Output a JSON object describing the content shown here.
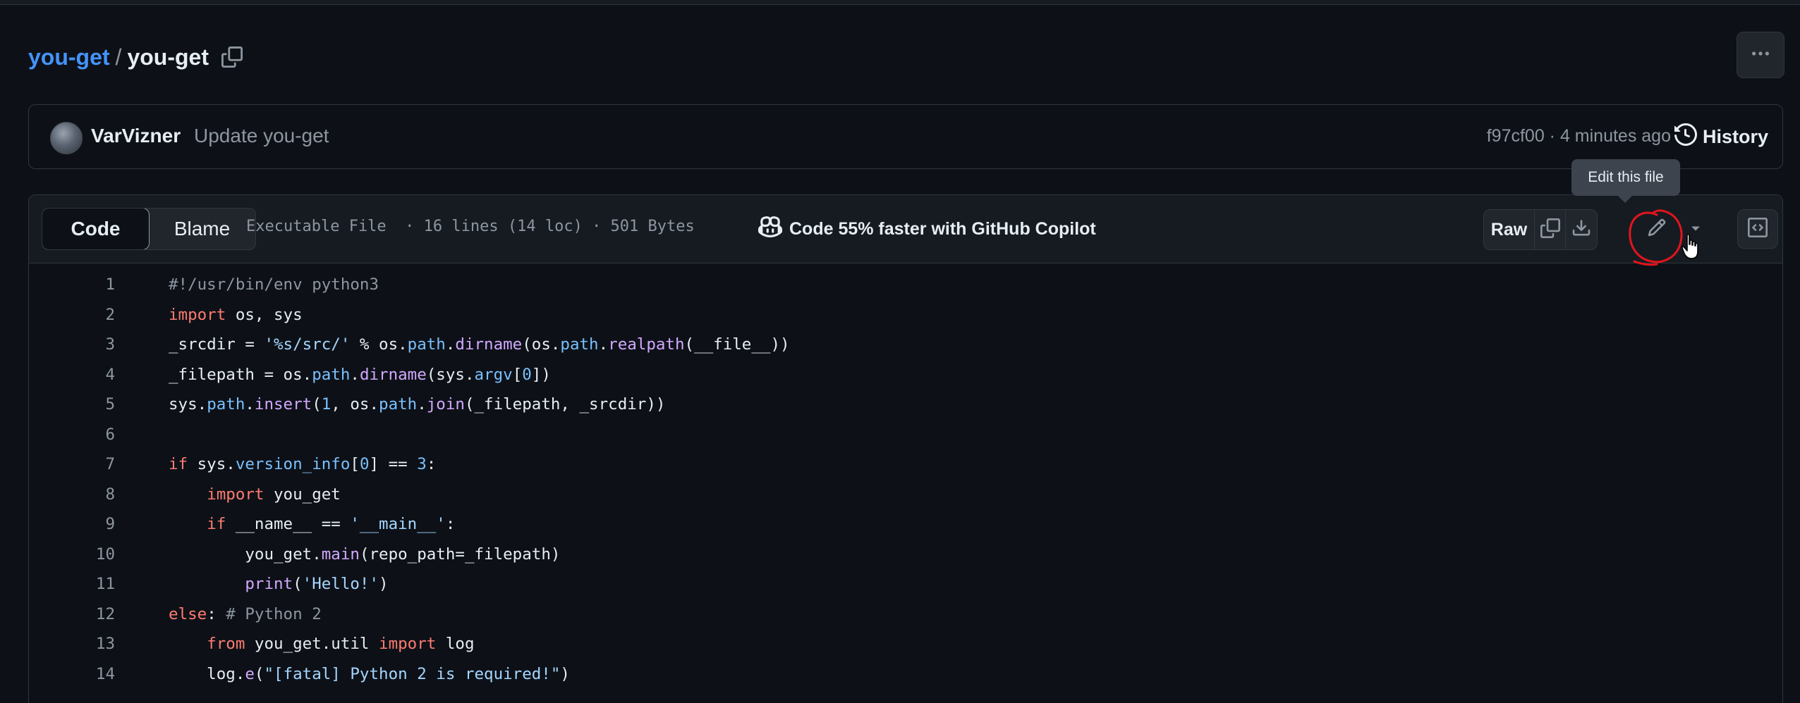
{
  "breadcrumb": {
    "repo": "you-get",
    "separator": "/",
    "file": "you-get"
  },
  "commit": {
    "author": "VarVizner",
    "message": "Update you-get",
    "meta": "f97cf00 · 4 minutes ago",
    "history_label": "History"
  },
  "tooltip": {
    "text": "Edit this file"
  },
  "file_header": {
    "tabs": [
      {
        "label": "Code",
        "active": true
      },
      {
        "label": "Blame",
        "active": false
      }
    ],
    "info": "Executable File  · 16 lines (14 loc) · 501 Bytes",
    "copilot": "Code 55% faster with GitHub Copilot",
    "raw_label": "Raw"
  },
  "icons": {
    "copy_path": "copy-icon",
    "more": "kebab-horizontal-icon",
    "history": "history-icon",
    "copilot": "copilot-icon",
    "copy_raw": "copy-icon",
    "download": "download-icon",
    "edit": "pencil-icon",
    "dropdown": "triangle-down-icon",
    "symbols": "code-square-icon"
  },
  "colors": {
    "background": "#0d1117",
    "link": "#4493f8",
    "annotation": "#e5141b"
  },
  "code_lines": [
    {
      "n": "1",
      "tokens": [
        [
          "cm",
          "#!/usr/bin/env python3"
        ]
      ]
    },
    {
      "n": "2",
      "tokens": [
        [
          "kw",
          "import"
        ],
        [
          "",
          " os, sys"
        ]
      ]
    },
    {
      "n": "3",
      "tokens": [
        [
          "",
          "_srcdir = "
        ],
        [
          "str",
          "'%s/src/'"
        ],
        [
          "",
          " % os."
        ],
        [
          "attr",
          "path"
        ],
        [
          "",
          "."
        ],
        [
          "fn",
          "dirname"
        ],
        [
          "",
          "(os."
        ],
        [
          "attr",
          "path"
        ],
        [
          "",
          "."
        ],
        [
          "fn",
          "realpath"
        ],
        [
          "",
          "(__file__))"
        ]
      ]
    },
    {
      "n": "4",
      "tokens": [
        [
          "",
          "_filepath = os."
        ],
        [
          "attr",
          "path"
        ],
        [
          "",
          "."
        ],
        [
          "fn",
          "dirname"
        ],
        [
          "",
          "(sys."
        ],
        [
          "attr",
          "argv"
        ],
        [
          "",
          "["
        ],
        [
          "num",
          "0"
        ],
        [
          "",
          "])"
        ]
      ]
    },
    {
      "n": "5",
      "tokens": [
        [
          "",
          "sys."
        ],
        [
          "attr",
          "path"
        ],
        [
          "",
          "."
        ],
        [
          "fn",
          "insert"
        ],
        [
          "",
          "("
        ],
        [
          "num",
          "1"
        ],
        [
          "",
          ", os."
        ],
        [
          "attr",
          "path"
        ],
        [
          "",
          "."
        ],
        [
          "fn",
          "join"
        ],
        [
          "",
          "(_filepath, _srcdir))"
        ]
      ]
    },
    {
      "n": "6",
      "tokens": []
    },
    {
      "n": "7",
      "tokens": [
        [
          "kw",
          "if"
        ],
        [
          "",
          " sys."
        ],
        [
          "attr",
          "version_info"
        ],
        [
          "",
          "["
        ],
        [
          "num",
          "0"
        ],
        [
          "",
          "] == "
        ],
        [
          "num",
          "3"
        ],
        [
          "",
          ":"
        ]
      ]
    },
    {
      "n": "8",
      "tokens": [
        [
          "",
          "    "
        ],
        [
          "kw",
          "import"
        ],
        [
          "",
          " you_get"
        ]
      ]
    },
    {
      "n": "9",
      "tokens": [
        [
          "",
          "    "
        ],
        [
          "kw",
          "if"
        ],
        [
          "",
          " __name__ == "
        ],
        [
          "str",
          "'__main__'"
        ],
        [
          "",
          ":"
        ]
      ]
    },
    {
      "n": "10",
      "tokens": [
        [
          "",
          "        you_get."
        ],
        [
          "fn",
          "main"
        ],
        [
          "",
          "(repo_path=_filepath)"
        ]
      ]
    },
    {
      "n": "11",
      "tokens": [
        [
          "",
          "        "
        ],
        [
          "fn",
          "print"
        ],
        [
          "",
          "("
        ],
        [
          "str",
          "'Hello!'"
        ],
        [
          "",
          ")"
        ]
      ]
    },
    {
      "n": "12",
      "tokens": [
        [
          "kw",
          "else"
        ],
        [
          "",
          ": "
        ],
        [
          "cm",
          "# Python 2"
        ]
      ]
    },
    {
      "n": "13",
      "tokens": [
        [
          "",
          "    "
        ],
        [
          "kw",
          "from"
        ],
        [
          "",
          " you_get.util "
        ],
        [
          "kw",
          "import"
        ],
        [
          "",
          " log"
        ]
      ]
    },
    {
      "n": "14",
      "tokens": [
        [
          "",
          "    log."
        ],
        [
          "fn",
          "e"
        ],
        [
          "",
          "("
        ],
        [
          "str",
          "\"[fatal] Python 2 is required!\""
        ],
        [
          "",
          ")"
        ]
      ]
    }
  ]
}
